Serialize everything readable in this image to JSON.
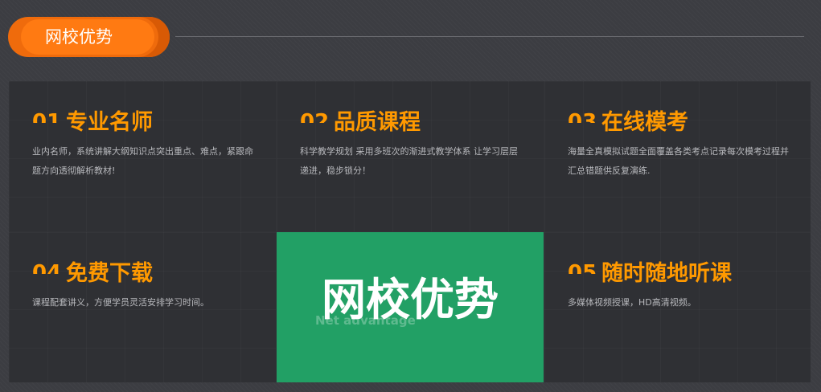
{
  "header": {
    "label": "网校优势"
  },
  "features": [
    {
      "num": "01",
      "title": "专业名师",
      "desc": "业内名师，系统讲解大纲知识点突出重点、难点，紧跟命题方向透彻解析教材!"
    },
    {
      "num": "02",
      "title": "品质课程",
      "desc": "科学教学规划 采用多班次的渐进式教学体系 让学习层层递进，稳步锁分！"
    },
    {
      "num": "03",
      "title": "在线模考",
      "desc": "海量全真模拟试题全面覆盖各类考点记录每次模考过程并汇总错题供反复演练."
    },
    {
      "num": "04",
      "title": "免费下载",
      "desc": "课程配套讲义，方便学员灵活安排学习时间。"
    },
    {
      "num": "05",
      "title": "随时随地听课",
      "desc": "多媒体视频授课，HD高清视频。"
    }
  ],
  "center": {
    "title": "网校优势",
    "subtitle": "Net advantage"
  },
  "colors": {
    "accent": "#ff9900",
    "pill": "#ff7a12",
    "center_bg": "#22a065",
    "background": "#3c3d42",
    "cell_bg": "#2f3034"
  }
}
